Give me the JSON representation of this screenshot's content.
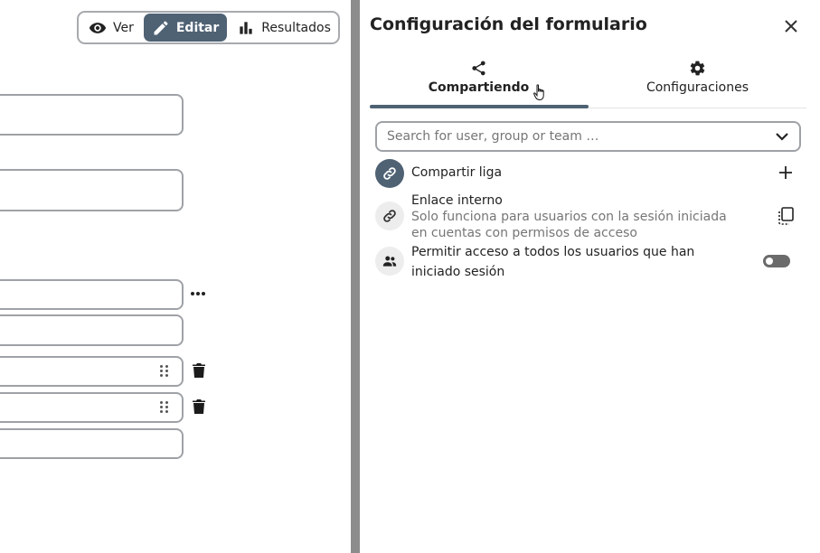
{
  "mode_switch": {
    "view_label": "Ver",
    "edit_label": "Editar",
    "results_label": "Resultados",
    "active": "edit"
  },
  "sidebar": {
    "title": "Configuración del formulario",
    "tabs": [
      {
        "label": "Compartiendo",
        "icon": "share-icon",
        "active": true
      },
      {
        "label": "Configuraciones",
        "icon": "gear-icon",
        "active": false
      }
    ],
    "search": {
      "placeholder": "Search for user, group or team …",
      "value": ""
    },
    "share_rows": [
      {
        "label": "Compartir liga",
        "icon": "link-icon",
        "action": "add-icon"
      },
      {
        "label": "Enlace interno",
        "sublabel": "Solo funciona para usuarios con la sesión iniciada en cuentas con permisos de acceso",
        "icon": "link-icon",
        "action": "copy-icon"
      },
      {
        "label": "Permitir acceso a todos los usuarios que han iniciado sesión",
        "icon": "users-icon",
        "action": "toggle",
        "toggle_on": false
      }
    ]
  },
  "colors": {
    "accent": "#4f6274",
    "divider": "#8c8c8c",
    "border": "#9ea2a6",
    "muted_text": "#767676"
  }
}
